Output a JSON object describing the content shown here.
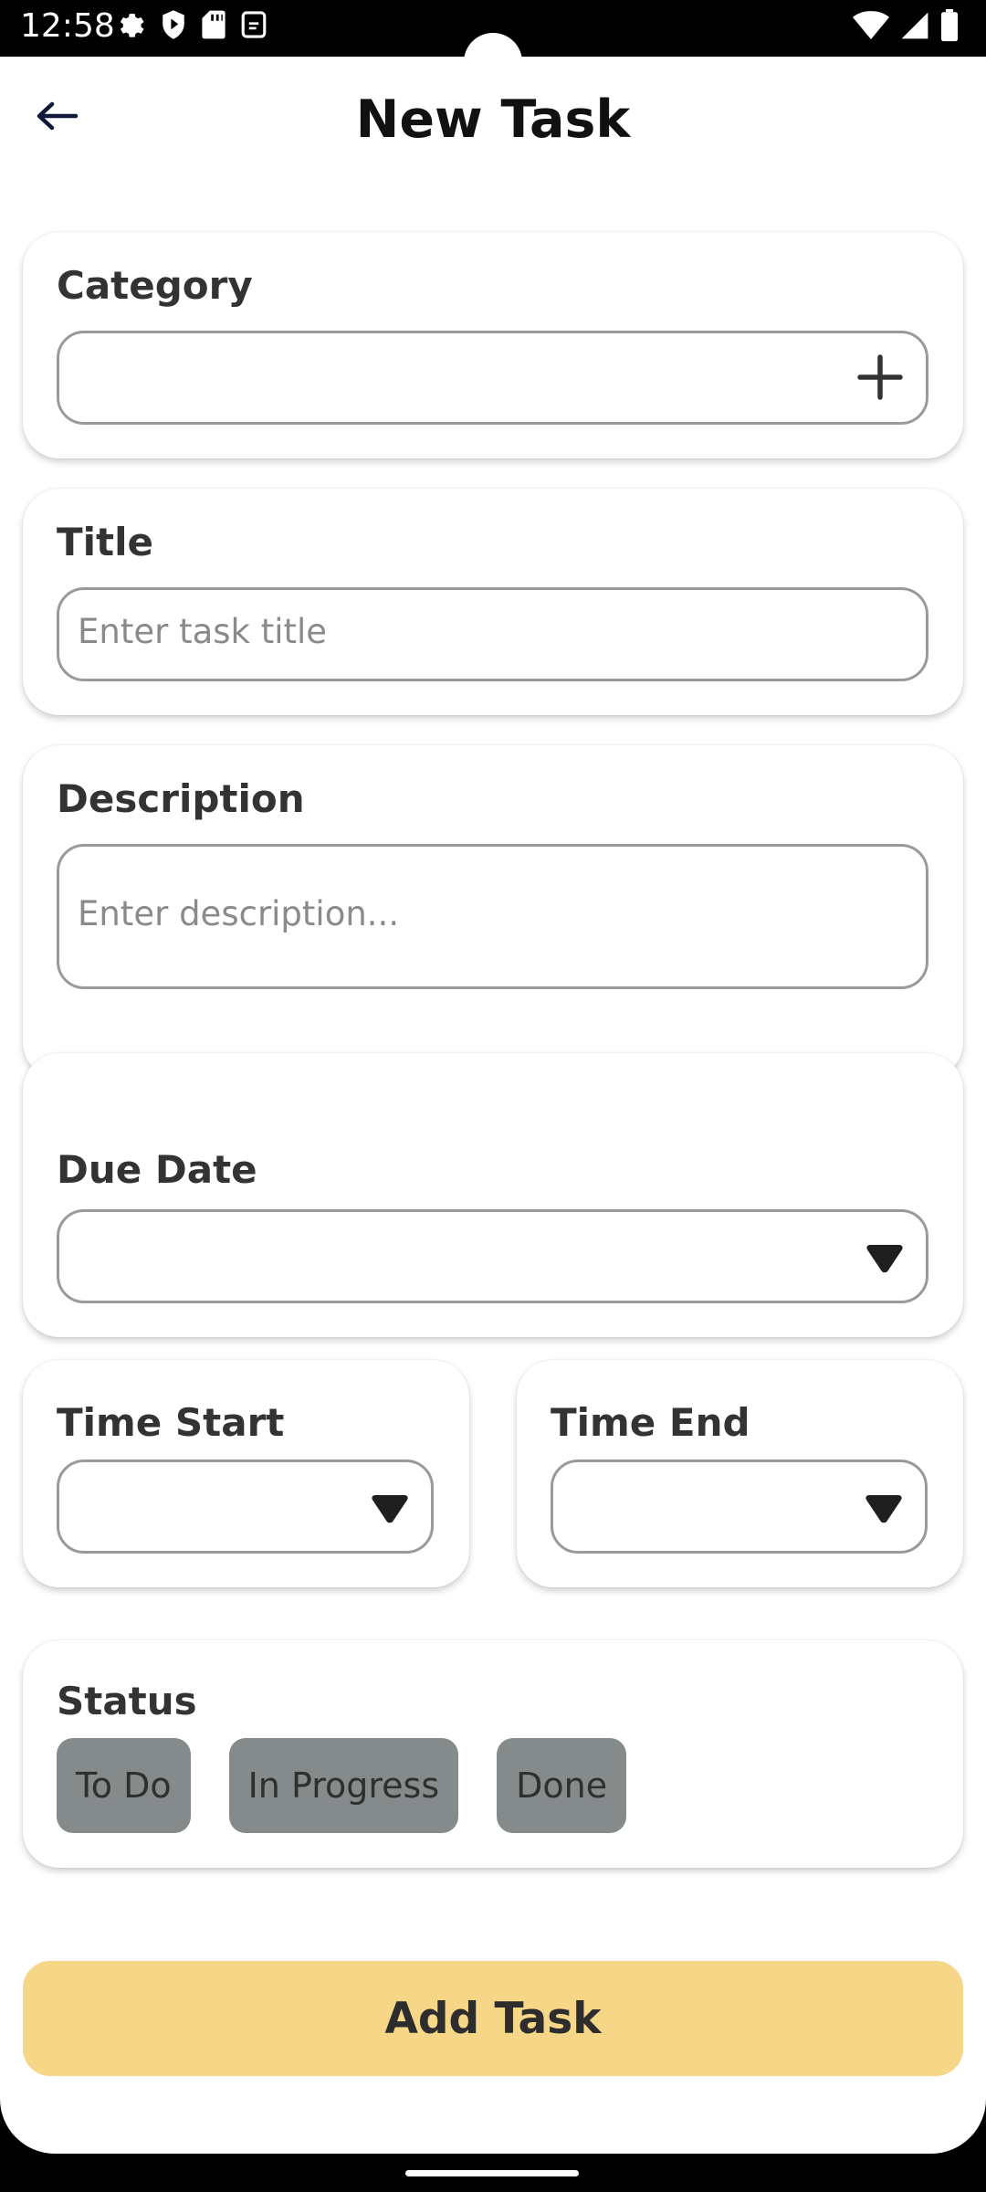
{
  "status_bar": {
    "time": "12:58",
    "left_icons": [
      "gear-icon",
      "play-shield-icon",
      "sd-card-icon",
      "screen-record-icon"
    ],
    "right_icons": [
      "wifi-icon",
      "cell-signal-icon",
      "battery-icon"
    ]
  },
  "header": {
    "title": "New Task",
    "back_icon": "arrow-left-icon"
  },
  "form": {
    "category": {
      "label": "Category",
      "value": "",
      "icon": "plus-icon"
    },
    "title": {
      "label": "Title",
      "placeholder": "Enter task title"
    },
    "description": {
      "label": "Description",
      "placeholder": "Enter description..."
    },
    "due_date": {
      "label": "Due Date",
      "value": "",
      "icon": "dropdown-triangle-icon"
    },
    "time_start": {
      "label": "Time Start",
      "value": "",
      "icon": "dropdown-triangle-icon"
    },
    "time_end": {
      "label": "Time End",
      "value": "",
      "icon": "dropdown-triangle-icon"
    },
    "status": {
      "label": "Status",
      "options": [
        "To Do",
        "In Progress",
        "Done"
      ]
    }
  },
  "actions": {
    "submit_label": "Add Task"
  },
  "colors": {
    "accent": "#f6d687",
    "chip_background": "#858b8b",
    "field_border": "#9a9a9a",
    "placeholder": "#8a8a8a"
  }
}
